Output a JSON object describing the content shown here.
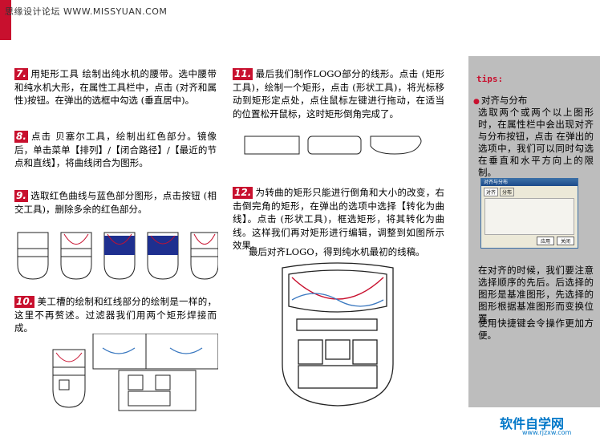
{
  "header": {
    "site": "思缘设计论坛  WWW.MISSYUAN.COM"
  },
  "steps": {
    "s7": {
      "num": "7.",
      "text": "用矩形工具 绘制出纯水机的腰带。选中腰带和纯水机大形，在属性工具栏中，点击 (对齐和属性)按钮。在弹出的选框中勾选 (垂直居中)。"
    },
    "s8": {
      "num": "8.",
      "text": "点击 贝塞尔工具，绘制出红色部分。镜像后，单击菜单【排列】/【闭合路径】/【最近的节点和直线】，将曲线闭合为图形。"
    },
    "s9": {
      "num": "9.",
      "text": "选取红色曲线与蓝色部分图形，点击按钮 (相交工具)，删除多余的红色部分。"
    },
    "s10": {
      "num": "10.",
      "text": "美工槽的绘制和红线部分的绘制是一样的，这里不再赘述。过滤器我们用两个矩形焊接而成。"
    },
    "s11": {
      "num": "11.",
      "text": "最后我们制作LOGO部分的线形。点击 (矩形工具)，绘制一个矩形，点击 (形状工具)，将光标移动到矩形定点处，点住鼠标左键进行拖动，在适当的位置松开鼠标，这时矩形倒角完成了。"
    },
    "s12": {
      "num": "12.",
      "text": "为转曲的矩形只能进行倒角和大小的改变，右击倒完角的矩形，在弹出的选项中选择【转化为曲线】。点击 (形状工具)，框选矩形，将其转化为曲线。这样我们再对矩形进行编辑，调整到如图所示效果。"
    },
    "final": "最后对齐LOGO，得到纯水机最初的线稿。"
  },
  "sidebar": {
    "tips_label": "tips:",
    "heading": "对齐与分布",
    "para1": "选取两个或两个以上图形时，在属性栏中会出现对齐与分布按钮，点击 在弹出的选项中，我们可以同时勾选在垂直和水平方向上的限制。",
    "para2": "在对齐的时候，我们要注意选择顺序的先后。后选择的图形是基准图形，先选择的图形根据基准图形而变换位置。",
    "para3": "使用快捷键会令操作更加方便。"
  },
  "dialog": {
    "title": "对齐与分布",
    "tab1": "对齐",
    "tab2": "分布",
    "btn_apply": "应用",
    "btn_close": "关闭"
  },
  "footer": {
    "logo": "软件自学网",
    "url": "www.rjzxw.com"
  },
  "colors": {
    "accent": "#c8102e",
    "blue": "#1e2f8f",
    "sidebar": "#bdbdbd"
  }
}
